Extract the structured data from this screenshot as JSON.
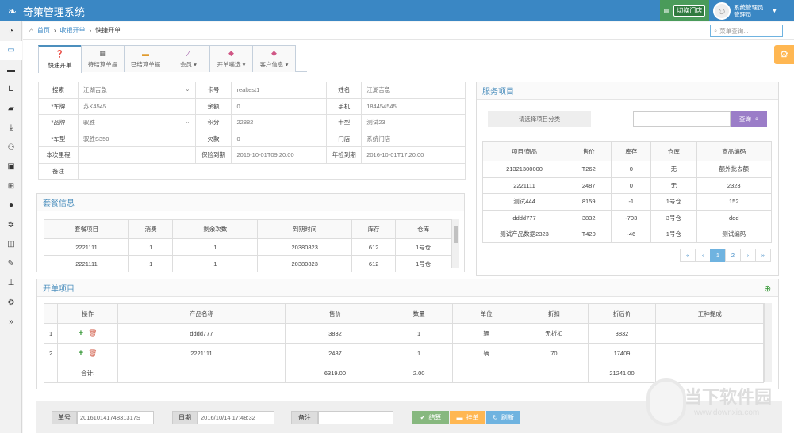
{
  "app": {
    "title": "奇策管理系统"
  },
  "header": {
    "switch_store_label": "切换门店",
    "user_line1": "系统管理员",
    "user_line2": "管理员"
  },
  "breadcrumb": {
    "home": "首页",
    "level1": "收银开单",
    "current": "快捷开单"
  },
  "menu_search": {
    "placeholder": "菜单查询..."
  },
  "tabs": [
    {
      "label": "快速开单",
      "icon": "question-circle-icon"
    },
    {
      "label": "待结算单据",
      "icon": "table-icon"
    },
    {
      "label": "已结算单据",
      "icon": "credit-card-icon"
    },
    {
      "label": "会员",
      "icon": "magic-wand-icon"
    },
    {
      "label": "开单嘴选",
      "icon": "tag-icon"
    },
    {
      "label": "客户信息",
      "icon": "tag-icon"
    }
  ],
  "form": {
    "search_label": "搜索",
    "search_value": "江湖吉急",
    "card_label": "卡号",
    "card_value": "realtest1",
    "name_label": "姓名",
    "name_value": "江湖吉急",
    "plate_label": "*车牌",
    "plate_value": "苏K4545",
    "balance_label": "余额",
    "balance_value": "0",
    "phone_label": "手机",
    "phone_value": "184454545",
    "brand_label": "*品牌",
    "brand_value": "驭胜",
    "points_label": "积分",
    "points_value": "22882",
    "cardtype_label": "卡型",
    "cardtype_value": "测试23",
    "model_label": "*车型",
    "model_value": "驭胜S350",
    "debt_label": "欠款",
    "debt_value": "0",
    "store_label": "门店",
    "store_value": "系统门店",
    "mileage_label": "本次里程",
    "mileage_value": "",
    "insurance_label": "保险到期",
    "insurance_value": "2016-10-01T09:20:00",
    "inspection_label": "年检到期",
    "inspection_value": "2016-10-01T17:20:00",
    "remark_label": "备注",
    "remark_value": ""
  },
  "package": {
    "title": "套餐信息",
    "headers": [
      "套餐项目",
      "消费",
      "剩余次数",
      "到期时间",
      "库存",
      "仓库"
    ],
    "rows": [
      [
        "2221111",
        "1",
        "1",
        "20380823",
        "612",
        "1号仓"
      ],
      [
        "2221111",
        "1",
        "1",
        "20380823",
        "612",
        "1号仓"
      ]
    ]
  },
  "service": {
    "title": "服务项目",
    "category_placeholder": "请选择项目分类",
    "query_label": "查询",
    "headers": [
      "项目/商品",
      "售价",
      "库存",
      "仓库",
      "商品编码"
    ],
    "rows": [
      [
        "21321300000",
        "T262",
        "0",
        "无",
        "额外批去额"
      ],
      [
        "2221111",
        "2487",
        "0",
        "无",
        "2323"
      ],
      [
        "测试444",
        "8159",
        "-1",
        "1号仓",
        "152"
      ],
      [
        "dddd777",
        "3832",
        "-703",
        "3号仓",
        "ddd"
      ],
      [
        "测试产品数据2323",
        "T420",
        "-46",
        "1号仓",
        "测试编码"
      ]
    ],
    "pager": [
      "«",
      "‹",
      "1",
      "2",
      "›",
      "»"
    ]
  },
  "order": {
    "title": "开单项目",
    "headers": [
      "",
      "操作",
      "产品名称",
      "售价",
      "数量",
      "单位",
      "折扣",
      "折后价",
      "工种提成"
    ],
    "rows": [
      {
        "index": "1",
        "name": "dddd777",
        "price": "3832",
        "qty": "1",
        "unit": "辆",
        "discount": "无折扣",
        "final": "3832",
        "commission": ""
      },
      {
        "index": "2",
        "name": "2221111",
        "price": "2487",
        "qty": "1",
        "unit": "辆",
        "discount": "70",
        "final": "17409",
        "commission": ""
      }
    ],
    "total_label": "合计:",
    "total_price": "6319.00",
    "total_qty": "2.00",
    "total_final": "21241.00"
  },
  "footer": {
    "order_no_label": "单号",
    "order_no_value": "20161014174831317S",
    "date_label": "日期",
    "date_value": "2016/10/14 17:48:32",
    "remark_label": "备注",
    "remark_value": "",
    "settle_label": "结算",
    "hold_label": "挂单",
    "refresh_label": "刷新"
  },
  "watermark": {
    "title": "当下软件园",
    "url": "www.downxia.com"
  },
  "colors": {
    "header": "#3a87c4",
    "green": "#87b87f",
    "orange": "#ffb752",
    "blue_btn": "#6fb3e0",
    "purple": "#9b7dc8"
  }
}
